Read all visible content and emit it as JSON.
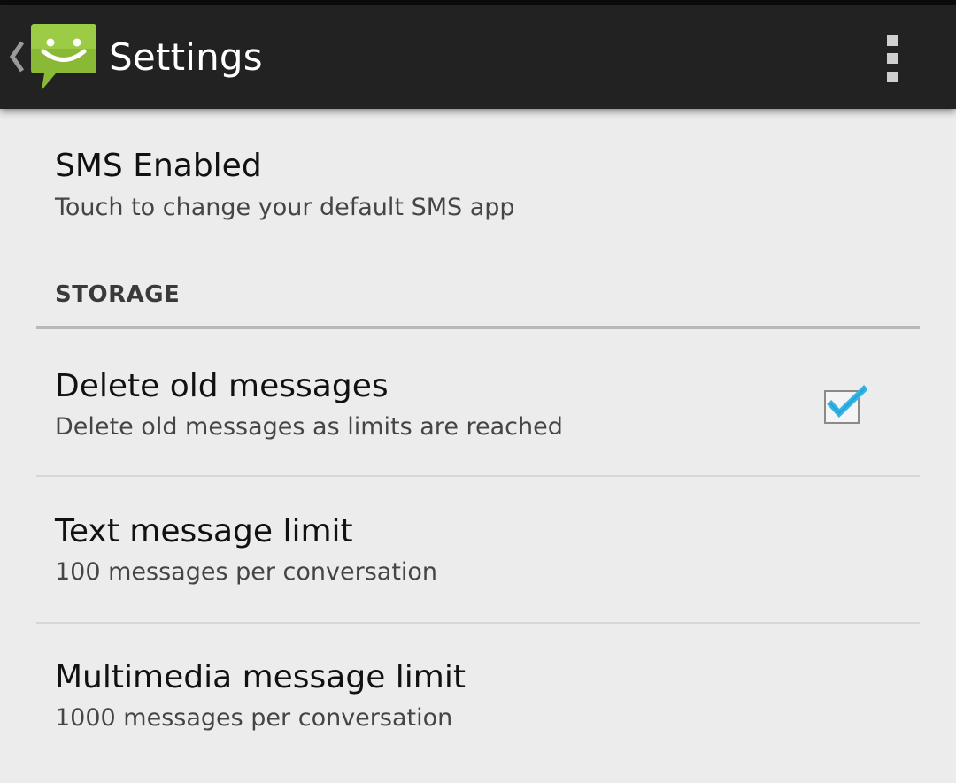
{
  "action_bar": {
    "title": "Settings",
    "back_icon": "chevron-left-icon",
    "app_icon": "messaging-app-icon",
    "overflow_icon": "overflow-menu-icon",
    "app_icon_color": "#8ab935"
  },
  "preferences": {
    "sms_enabled": {
      "title": "SMS Enabled",
      "summary": "Touch to change your default SMS app"
    },
    "storage_category": {
      "label": "STORAGE"
    },
    "delete_old_messages": {
      "title": "Delete old messages",
      "summary": "Delete old messages as limits are reached",
      "checked": true
    },
    "text_message_limit": {
      "title": "Text message limit",
      "summary": "100 messages per conversation"
    },
    "multimedia_message_limit": {
      "title": "Multimedia message limit",
      "summary": "1000 messages per conversation"
    }
  },
  "colors": {
    "action_bar_bg": "#222222",
    "background": "#ececec",
    "checkbox_accent": "#33b5e5"
  }
}
